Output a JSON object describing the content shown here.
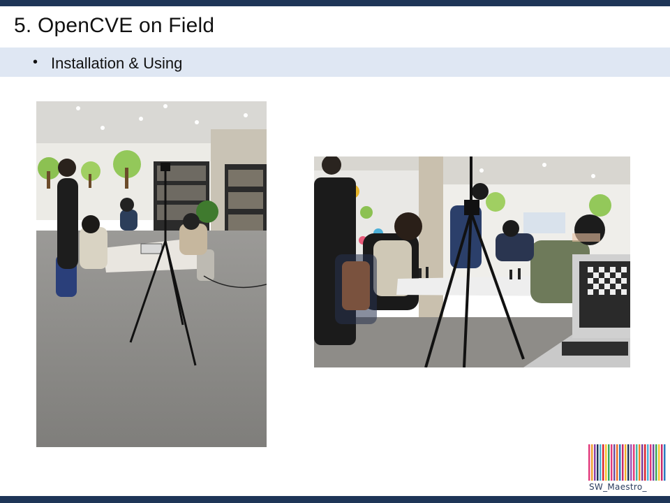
{
  "slide": {
    "title": "5. OpenCVE on Field",
    "bullet_glyph": "•",
    "subtitle": "Installation & Using"
  },
  "photos": [
    {
      "description_icon": "photo-chess-room-wide"
    },
    {
      "description_icon": "photo-chess-players-closeup"
    }
  ],
  "logo": {
    "text": "SW_Maestro_",
    "stripe_colors": [
      "#e23a7c",
      "#f0a030",
      "#8a3fa6",
      "#1e3557",
      "#4db0d8",
      "#d9262e",
      "#f7c531",
      "#3ba55c",
      "#e23a7c",
      "#6c4ea0",
      "#ef6f2a",
      "#2a7bc0",
      "#c82a6a",
      "#f2b12a",
      "#1e3557",
      "#9b59b6",
      "#e23a7c",
      "#45b3a6",
      "#f08a24",
      "#7a3a9a",
      "#d9262e",
      "#4db0d8",
      "#e23a7c",
      "#6c4ea0",
      "#3ba55c",
      "#f7c531",
      "#c82a6a",
      "#2a7bc0"
    ]
  },
  "colors": {
    "bar": "#1e3557",
    "subtitle_band": "#dfe7f3"
  }
}
